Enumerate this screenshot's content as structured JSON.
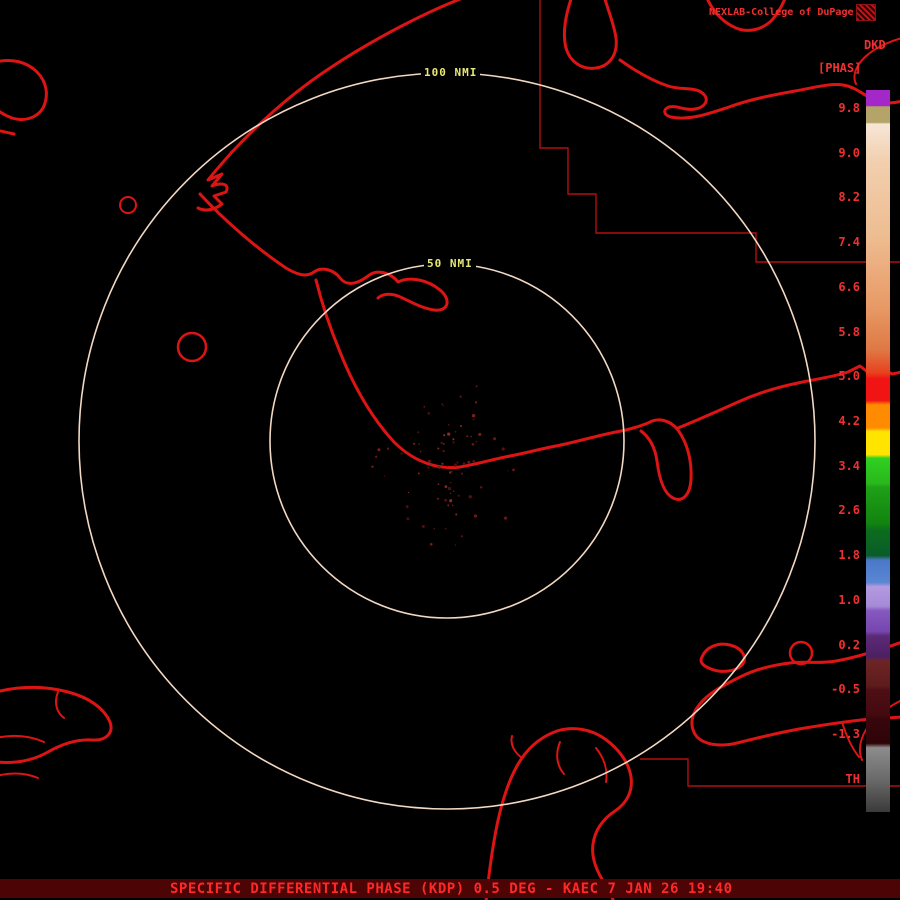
{
  "header": {
    "attribution": "NEXLAB-College of DuPage",
    "product_code": "DKD",
    "units": "[PHAS]"
  },
  "rings": [
    {
      "label": "100 NMI"
    },
    {
      "label": "50 NMI"
    }
  ],
  "colorbar": {
    "tick_labels": [
      "9.8",
      "9.0",
      "8.2",
      "7.4",
      "6.6",
      "5.8",
      "5.0",
      "4.2",
      "3.4",
      "2.6",
      "1.8",
      "1.0",
      "0.2",
      "-0.5",
      "-1.3",
      "TH"
    ],
    "gradient_stops": [
      [
        0.0,
        "#a428c8"
      ],
      [
        0.022,
        "#a428c8"
      ],
      [
        0.023,
        "#b4a468"
      ],
      [
        0.045,
        "#b4a468"
      ],
      [
        0.047,
        "#f6e6d6"
      ],
      [
        0.1,
        "#f2cfae"
      ],
      [
        0.2,
        "#eebd92"
      ],
      [
        0.3,
        "#e89a66"
      ],
      [
        0.36,
        "#df7844"
      ],
      [
        0.392,
        "#e8401e"
      ],
      [
        0.4,
        "#f01414"
      ],
      [
        0.43,
        "#f01414"
      ],
      [
        0.436,
        "#ff8c00"
      ],
      [
        0.468,
        "#ff8c00"
      ],
      [
        0.473,
        "#ffe400"
      ],
      [
        0.505,
        "#ffe400"
      ],
      [
        0.51,
        "#30d020"
      ],
      [
        0.545,
        "#28b81c"
      ],
      [
        0.55,
        "#1fa016"
      ],
      [
        0.6,
        "#128410"
      ],
      [
        0.61,
        "#0c6c1e"
      ],
      [
        0.645,
        "#0a5c2a"
      ],
      [
        0.651,
        "#4a78c8"
      ],
      [
        0.682,
        "#5a86d2"
      ],
      [
        0.688,
        "#b49ae0"
      ],
      [
        0.715,
        "#a58ad8"
      ],
      [
        0.721,
        "#8659c0"
      ],
      [
        0.75,
        "#7646ae"
      ],
      [
        0.756,
        "#5c2a78"
      ],
      [
        0.785,
        "#4c2062"
      ],
      [
        0.791,
        "#6e2424"
      ],
      [
        0.825,
        "#5e1c1c"
      ],
      [
        0.831,
        "#4e0f14"
      ],
      [
        0.865,
        "#430a10"
      ],
      [
        0.871,
        "#38060c"
      ],
      [
        0.905,
        "#2e0408"
      ],
      [
        0.911,
        "#8c8c8c"
      ],
      [
        0.955,
        "#6a6a6a"
      ],
      [
        1.0,
        "#3a3a3a"
      ]
    ]
  },
  "footer": {
    "product_line": "SPECIFIC DIFFERENTIAL PHASE (KDP) 0.5 DEG - KAEC 7 JAN 26 19:40"
  },
  "map": {
    "echo_colors": [
      "#5a1010",
      "#701515",
      "#49100e",
      "#7d1d16",
      "#8a2a22"
    ]
  },
  "colors": {
    "background": "#000000",
    "map_line": "#dc1414",
    "boundary_line": "#b01010",
    "range_ring": "#f2d8c2",
    "ring_label": "#e8e876",
    "text_red": "#f03030",
    "footer_bg": "#4c0404",
    "footer_text": "#ff2828"
  }
}
